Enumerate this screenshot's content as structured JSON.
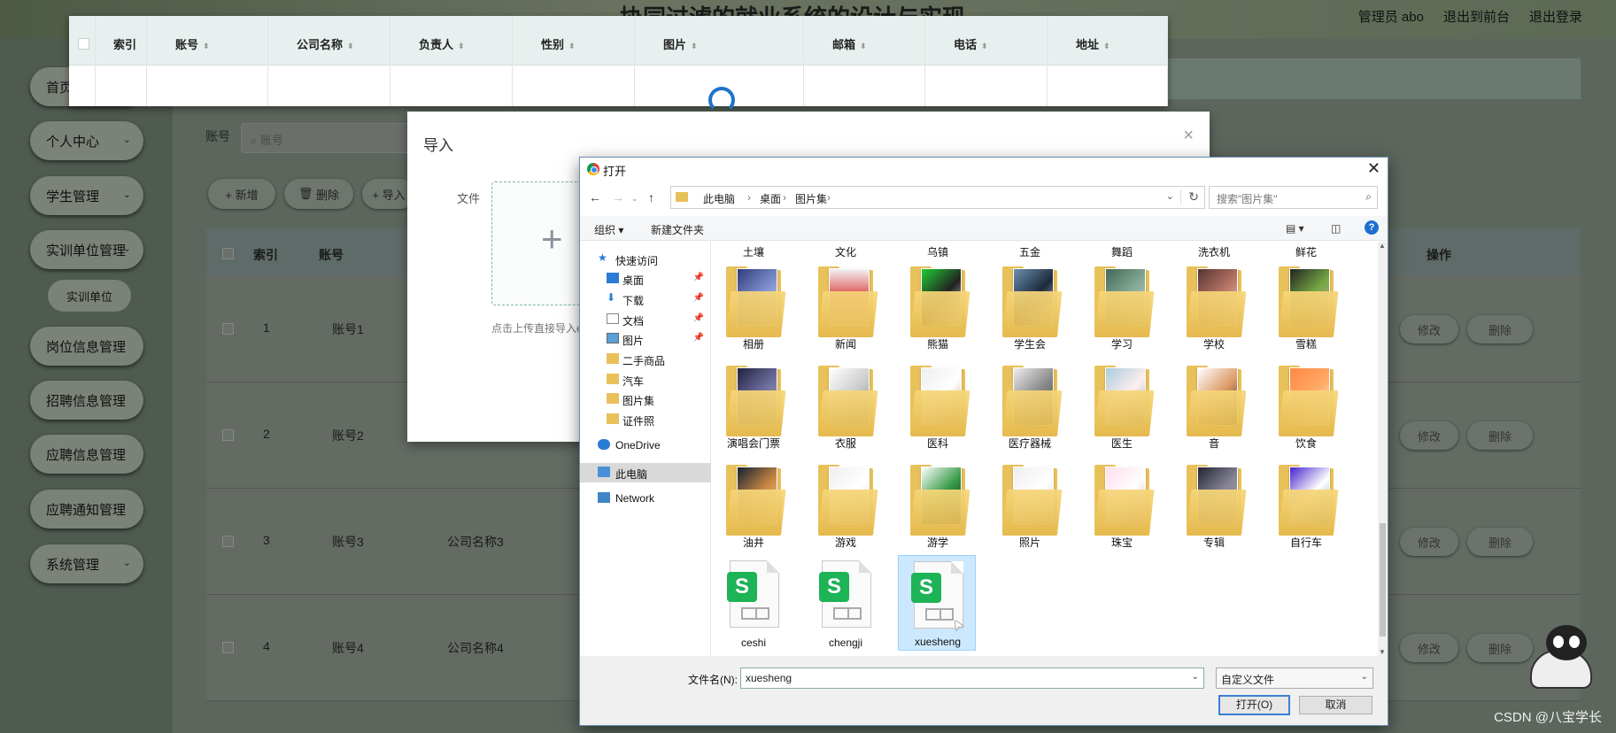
{
  "app": {
    "title": "协同过滤的就业系统的设计与实现",
    "topnav": [
      "管理员 abo",
      "退出到前台",
      "退出登录"
    ],
    "sidebar": [
      {
        "label": "首页",
        "chevron": false
      },
      {
        "label": "个人中心",
        "chevron": true
      },
      {
        "label": "学生管理",
        "chevron": true
      },
      {
        "label": "实训单位管理",
        "chevron": true
      },
      {
        "label": "实训单位",
        "sub": true
      },
      {
        "label": "岗位信息管理",
        "chevron": false
      },
      {
        "label": "招聘信息管理",
        "chevron": false
      },
      {
        "label": "应聘信息管理",
        "chevron": false
      },
      {
        "label": "应聘通知管理",
        "chevron": false
      },
      {
        "label": "系统管理",
        "chevron": true
      }
    ],
    "filter_label": "账号",
    "search_placeholder": "账号",
    "actions": [
      "+ 新增",
      "删除",
      "+ 导入"
    ],
    "table_headers": [
      "索引",
      "账号",
      "公司名称",
      "负责人",
      "性别",
      "图片",
      "邮箱",
      "电话",
      "地址",
      "操作"
    ],
    "rows": [
      {
        "index": "1",
        "account": "账号1",
        "company": ""
      },
      {
        "index": "2",
        "account": "账号2",
        "company": ""
      },
      {
        "index": "3",
        "account": "账号3",
        "company": "公司名称3"
      },
      {
        "index": "4",
        "account": "账号4",
        "company": "公司名称4"
      }
    ],
    "row_actions": [
      "修改",
      "删除"
    ]
  },
  "float_header": {
    "columns": [
      "索引",
      "账号",
      "公司名称",
      "负责人",
      "性别",
      "图片",
      "邮箱",
      "电话",
      "地址"
    ]
  },
  "import_dialog": {
    "title": "导入",
    "file_label": "文件",
    "tip": "点击上传直接导入excel"
  },
  "file_dialog": {
    "title": "打开",
    "path": [
      "此电脑",
      "桌面",
      "图片集"
    ],
    "search_placeholder": "搜索\"图片集\"",
    "toolbar": {
      "organize": "组织 ▾",
      "new_folder": "新建文件夹"
    },
    "nav": [
      {
        "label": "快速访问",
        "icon": "star-icon",
        "pin": false,
        "indent": 0
      },
      {
        "label": "桌面",
        "icon": "desktop-icon",
        "pin": true,
        "indent": 1
      },
      {
        "label": "下载",
        "icon": "download-icon",
        "pin": true,
        "indent": 1
      },
      {
        "label": "文档",
        "icon": "document-icon",
        "pin": true,
        "indent": 1
      },
      {
        "label": "图片",
        "icon": "picture-icon",
        "pin": true,
        "indent": 1
      },
      {
        "label": "二手商品",
        "icon": "folder-icon",
        "pin": false,
        "indent": 1
      },
      {
        "label": "汽车",
        "icon": "folder-icon",
        "pin": false,
        "indent": 1
      },
      {
        "label": "图片集",
        "icon": "folder-icon",
        "pin": false,
        "indent": 1
      },
      {
        "label": "证件照",
        "icon": "folder-icon",
        "pin": false,
        "indent": 1
      },
      {
        "label": "OneDrive",
        "icon": "cloud-icon",
        "pin": false,
        "indent": 0
      },
      {
        "label": "此电脑",
        "icon": "computer-icon",
        "pin": false,
        "indent": 0,
        "selected": true
      },
      {
        "label": "Network",
        "icon": "network-icon",
        "pin": false,
        "indent": 0
      }
    ],
    "top_partial_captions": [
      "土壤",
      "文化",
      "乌镇",
      "五金",
      "舞蹈",
      "洗衣机",
      "鲜花"
    ],
    "folders_row1": [
      "相册",
      "新闻",
      "熊猫",
      "学生会",
      "学习",
      "学校",
      "雪糕"
    ],
    "folders_row2": [
      "演唱会门票",
      "衣服",
      "医科",
      "医疗器械",
      "医生",
      "音",
      "饮食"
    ],
    "folders_row3": [
      "油井",
      "游戏",
      "游学",
      "照片",
      "珠宝",
      "专辑",
      "自行车"
    ],
    "files": [
      "ceshi",
      "chengji",
      "xuesheng"
    ],
    "selected_file": "xuesheng",
    "filename_label": "文件名(N):",
    "filename_value": "xuesheng",
    "filetype": "自定义文件",
    "open_button": "打开(O)",
    "cancel_button": "取消"
  },
  "watermark": "CSDN @八宝学长",
  "colors": {
    "accent": "#3c7fd3",
    "folder": "#e9c15a",
    "sheet_logo": "#1db357"
  }
}
